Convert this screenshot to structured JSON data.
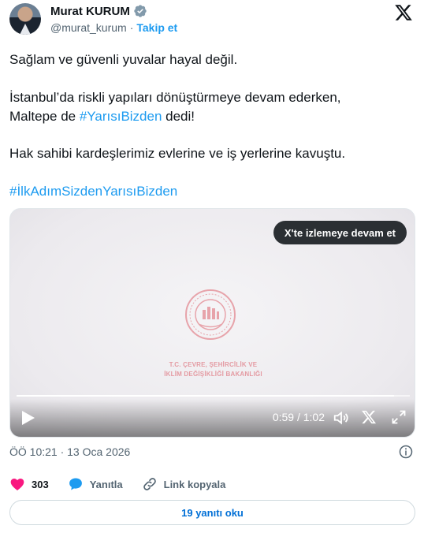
{
  "author": {
    "name": "Murat KURUM",
    "handle": "@murat_kurum",
    "separator": "·",
    "follow_label": "Takip et"
  },
  "tweet": {
    "line1": "Sağlam ve güvenli yuvalar hayal değil.",
    "line2a": "İstanbul’da riskli yapıları dönüştürmeye devam ederken,",
    "line2b_prefix": "Maltepe de ",
    "line2b_tag": "#YarısıBizden",
    "line2b_suffix": " dedi!",
    "line3": "Hak sahibi kardeşlerimiz evlerine ve iş yerlerine kavuştu.",
    "line4_tag": "#İlkAdımSizdenYarısıBizden"
  },
  "video": {
    "continue_label": "X'te izlemeye devam et",
    "ministry_line1": "T.C. ÇEVRE, ŞEHİRCİLİK VE",
    "ministry_line2": "İKLİM DEĞİŞİKLİĞİ BAKANLIĞI",
    "time": "0:59 / 1:02",
    "progress_fraction": 0.96
  },
  "meta": {
    "timestamp": "ÖÖ 10:21 · 13 Oca 2026"
  },
  "actions": {
    "likes": "303",
    "reply_label": "Yanıtla",
    "copy_link_label": "Link kopyala"
  },
  "replies_button": "19 yanıtı oku",
  "colors": {
    "accent": "#1d9bf0",
    "like": "#f91880",
    "text": "#0f1419",
    "muted": "#536471"
  },
  "icons": [
    "verified-badge-icon",
    "x-logo-icon",
    "play-icon",
    "volume-icon",
    "x-icon",
    "fullscreen-icon",
    "info-icon",
    "heart-icon",
    "reply-icon",
    "link-icon"
  ]
}
